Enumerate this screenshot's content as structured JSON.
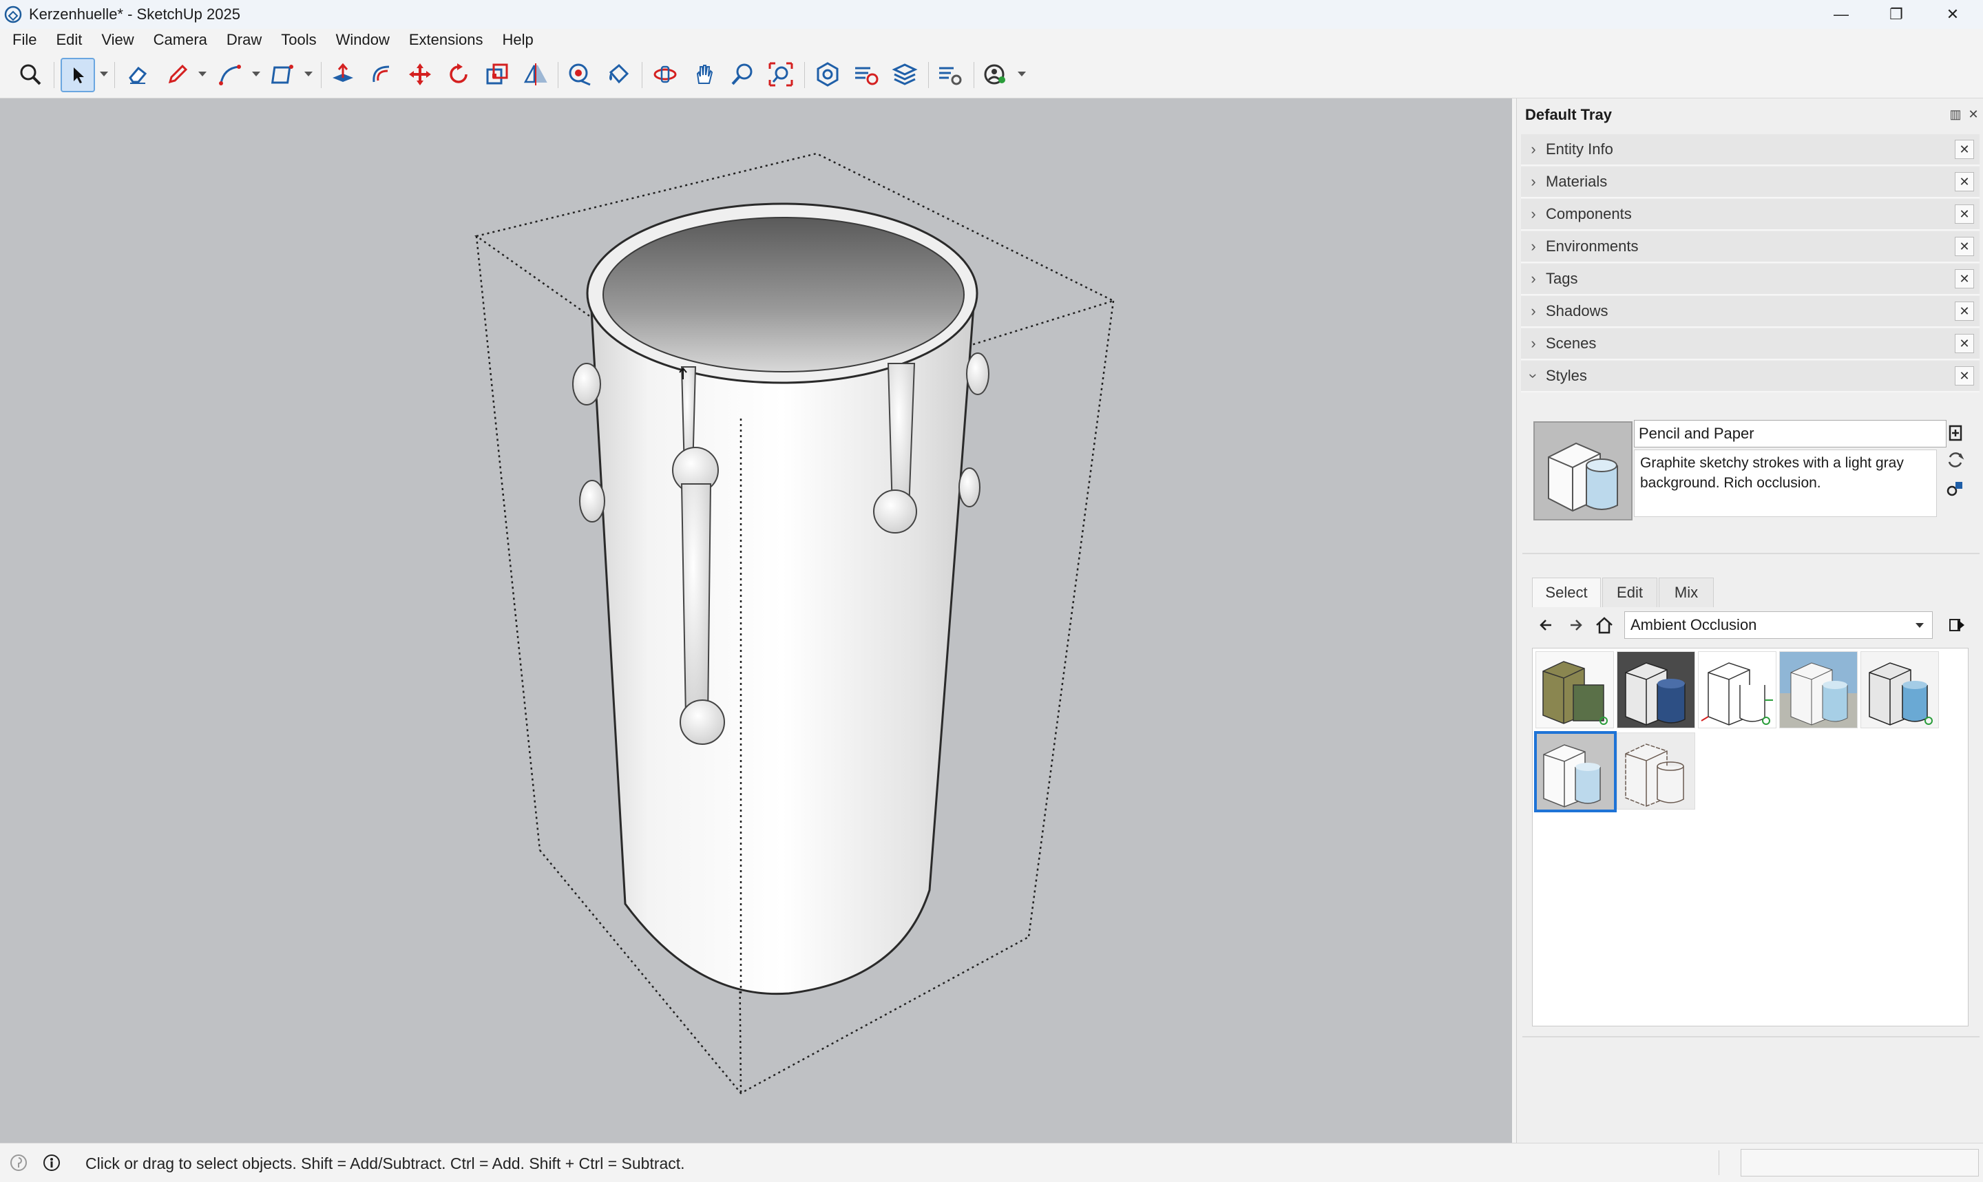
{
  "window": {
    "title": "Kerzenhuelle* - SketchUp 2025",
    "controls": {
      "minimize": "—",
      "maximize": "❐",
      "close": "✕"
    }
  },
  "menu": [
    "File",
    "Edit",
    "View",
    "Camera",
    "Draw",
    "Tools",
    "Window",
    "Extensions",
    "Help"
  ],
  "toolbar": {
    "tools": [
      "zoom-icon",
      "select-icon",
      "eraser-icon",
      "pencil-icon",
      "line-icon",
      "rectangle-icon",
      "push-pull-icon",
      "follow-me-icon",
      "move-icon",
      "rotate-icon",
      "scale-icon",
      "flip-icon",
      "tape-measure-icon",
      "paint-bucket-icon",
      "orbit-icon",
      "pan-icon",
      "zoom-tool-icon",
      "zoom-extents-icon",
      "warehouse-icon",
      "extension-warehouse-icon",
      "layout-icon",
      "extension-manager-icon",
      "account-icon"
    ],
    "active_tool": "select-icon"
  },
  "tray": {
    "title": "Default Tray",
    "panels": [
      {
        "label": "Entity Info",
        "expanded": false
      },
      {
        "label": "Materials",
        "expanded": false
      },
      {
        "label": "Components",
        "expanded": false
      },
      {
        "label": "Environments",
        "expanded": false
      },
      {
        "label": "Tags",
        "expanded": false
      },
      {
        "label": "Shadows",
        "expanded": false
      },
      {
        "label": "Scenes",
        "expanded": false
      },
      {
        "label": "Styles",
        "expanded": true
      }
    ],
    "close_glyph": "✕",
    "styles": {
      "name": "Pencil and Paper",
      "description": "Graphite sketchy strokes with a light gray background. Rich occlusion.",
      "tabs": [
        "Select",
        "Edit",
        "Mix"
      ],
      "active_tab": "Select",
      "collection": "Ambient Occlusion",
      "selected_index": 5
    }
  },
  "status": {
    "text": "Click or drag to select objects. Shift = Add/Subtract. Ctrl = Add. Shift + Ctrl = Subtract."
  },
  "colors": {
    "viewport_bg": "#bfc1c4",
    "selection_blue": "#1e73d6",
    "tool_red": "#d42020",
    "tool_blue": "#1f5fa8"
  }
}
